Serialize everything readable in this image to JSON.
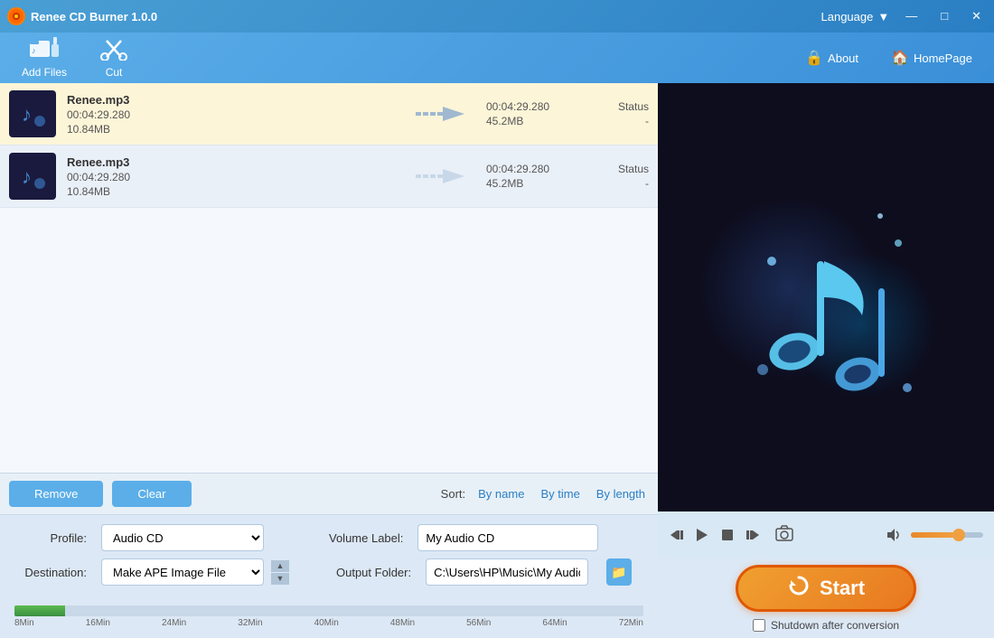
{
  "titlebar": {
    "logo_text": "●",
    "app_name": "Renee CD Burner 1.0.0",
    "lang_label": "Language",
    "lang_icon": "▼",
    "minimize": "—",
    "maximize": "□",
    "close": "✕"
  },
  "toolbar": {
    "add_files_label": "Add Files",
    "cut_label": "Cut",
    "about_label": "About",
    "homepage_label": "HomePage"
  },
  "file_list": {
    "rows": [
      {
        "name": "Renee.mp3",
        "duration": "00:04:29.280",
        "size": "10.84MB",
        "output_duration": "00:04:29.280",
        "output_size": "45.2MB",
        "status_label": "Status",
        "status_value": "-",
        "highlighted": true
      },
      {
        "name": "Renee.mp3",
        "duration": "00:04:29.280",
        "size": "10.84MB",
        "output_duration": "00:04:29.280",
        "output_size": "45.2MB",
        "status_label": "Status",
        "status_value": "-",
        "highlighted": false
      }
    ]
  },
  "controls": {
    "remove_label": "Remove",
    "clear_label": "Clear",
    "sort_label": "Sort:",
    "sort_by_name": "By name",
    "sort_by_time": "By time",
    "sort_by_length": "By length"
  },
  "settings": {
    "profile_label": "Profile:",
    "profile_value": "Audio CD",
    "volume_label": "Volume Label:",
    "volume_value": "My Audio CD",
    "destination_label": "Destination:",
    "destination_value": "Make APE Image File",
    "output_folder_label": "Output Folder:",
    "output_folder_value": "C:\\Users\\HP\\Music\\My Audio CD.ape"
  },
  "progress": {
    "labels": [
      "8Min",
      "16Min",
      "24Min",
      "32Min",
      "40Min",
      "48Min",
      "56Min",
      "64Min",
      "72Min"
    ]
  },
  "player": {
    "skip_back_icon": "⏮",
    "play_icon": "▶",
    "stop_icon": "■",
    "skip_forward_icon": "⏭",
    "camera_icon": "📷",
    "volume_icon": "🔊"
  },
  "start_btn": {
    "label": "Start",
    "shutdown_label": "Shutdown after conversion"
  }
}
